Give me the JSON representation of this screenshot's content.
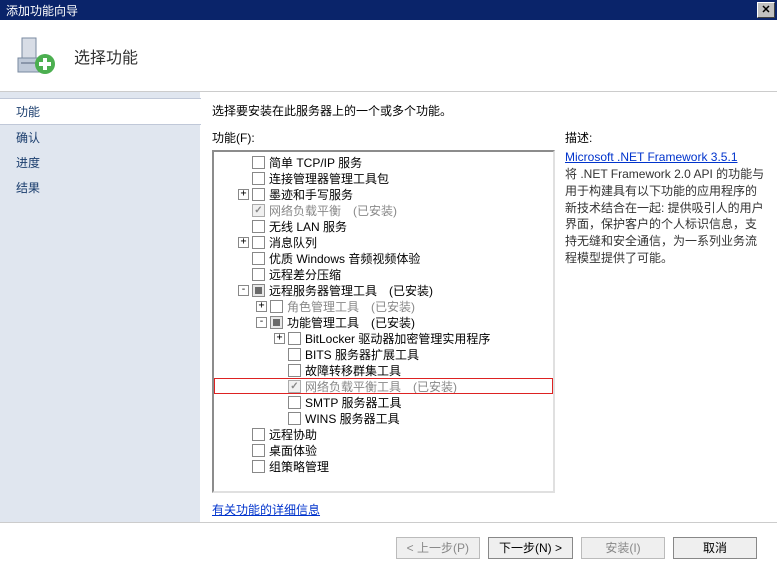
{
  "window": {
    "title": "添加功能向导"
  },
  "header": {
    "title": "选择功能"
  },
  "sidebar": {
    "items": [
      {
        "label": "功能",
        "active": true
      },
      {
        "label": "确认"
      },
      {
        "label": "进度"
      },
      {
        "label": "结果"
      }
    ]
  },
  "main": {
    "instruction": "选择要安装在此服务器上的一个或多个功能。",
    "features_label": "功能(F):",
    "desc_label": "描述:",
    "more_link": "有关功能的详细信息"
  },
  "tree": [
    {
      "indent": 0,
      "exp": "",
      "cb": "",
      "label": "简单 TCP/IP 服务"
    },
    {
      "indent": 0,
      "exp": "",
      "cb": "",
      "label": "连接管理器管理工具包"
    },
    {
      "indent": 0,
      "exp": "+",
      "cb": "",
      "label": "墨迹和手写服务"
    },
    {
      "indent": 0,
      "exp": "",
      "cb": "checked disabled",
      "label": "网络负载平衡　(已安装)",
      "labelClass": "disabled"
    },
    {
      "indent": 0,
      "exp": "",
      "cb": "",
      "label": "无线 LAN 服务"
    },
    {
      "indent": 0,
      "exp": "+",
      "cb": "",
      "label": "消息队列"
    },
    {
      "indent": 0,
      "exp": "",
      "cb": "",
      "label": "优质 Windows 音频视频体验"
    },
    {
      "indent": 0,
      "exp": "",
      "cb": "",
      "label": "远程差分压缩"
    },
    {
      "indent": 0,
      "exp": "-",
      "cb": "tri",
      "label": "远程服务器管理工具　(已安装)"
    },
    {
      "indent": 1,
      "exp": "+",
      "cb": "",
      "label": "角色管理工具　(已安装)",
      "labelClass": "disabled"
    },
    {
      "indent": 1,
      "exp": "-",
      "cb": "tri",
      "label": "功能管理工具　(已安装)"
    },
    {
      "indent": 2,
      "exp": "+",
      "cb": "",
      "label": "BitLocker 驱动器加密管理实用程序"
    },
    {
      "indent": 2,
      "exp": "",
      "cb": "",
      "label": "BITS 服务器扩展工具"
    },
    {
      "indent": 2,
      "exp": "",
      "cb": "",
      "label": "故障转移群集工具"
    },
    {
      "indent": 2,
      "exp": "",
      "cb": "checked disabled",
      "label": "网络负载平衡工具　(已安装)",
      "labelClass": "disabled",
      "highlight": true
    },
    {
      "indent": 2,
      "exp": "",
      "cb": "",
      "label": "SMTP 服务器工具"
    },
    {
      "indent": 2,
      "exp": "",
      "cb": "",
      "label": "WINS 服务器工具"
    },
    {
      "indent": 0,
      "exp": "",
      "cb": "",
      "label": "远程协助"
    },
    {
      "indent": 0,
      "exp": "",
      "cb": "",
      "label": "桌面体验"
    },
    {
      "indent": 0,
      "exp": "",
      "cb": "",
      "label": "组策略管理"
    }
  ],
  "desc": {
    "title": "Microsoft .NET Framework 3.5.1",
    "text": "将 .NET Framework 2.0 API 的功能与用于构建具有以下功能的应用程序的新技术结合在一起: 提供吸引人的用户界面，保护客户的个人标识信息，支持无缝和安全通信，为一系列业务流程模型提供了可能。"
  },
  "footer": {
    "prev": "< 上一步(P)",
    "next": "下一步(N) >",
    "install": "安装(I)",
    "cancel": "取消"
  }
}
